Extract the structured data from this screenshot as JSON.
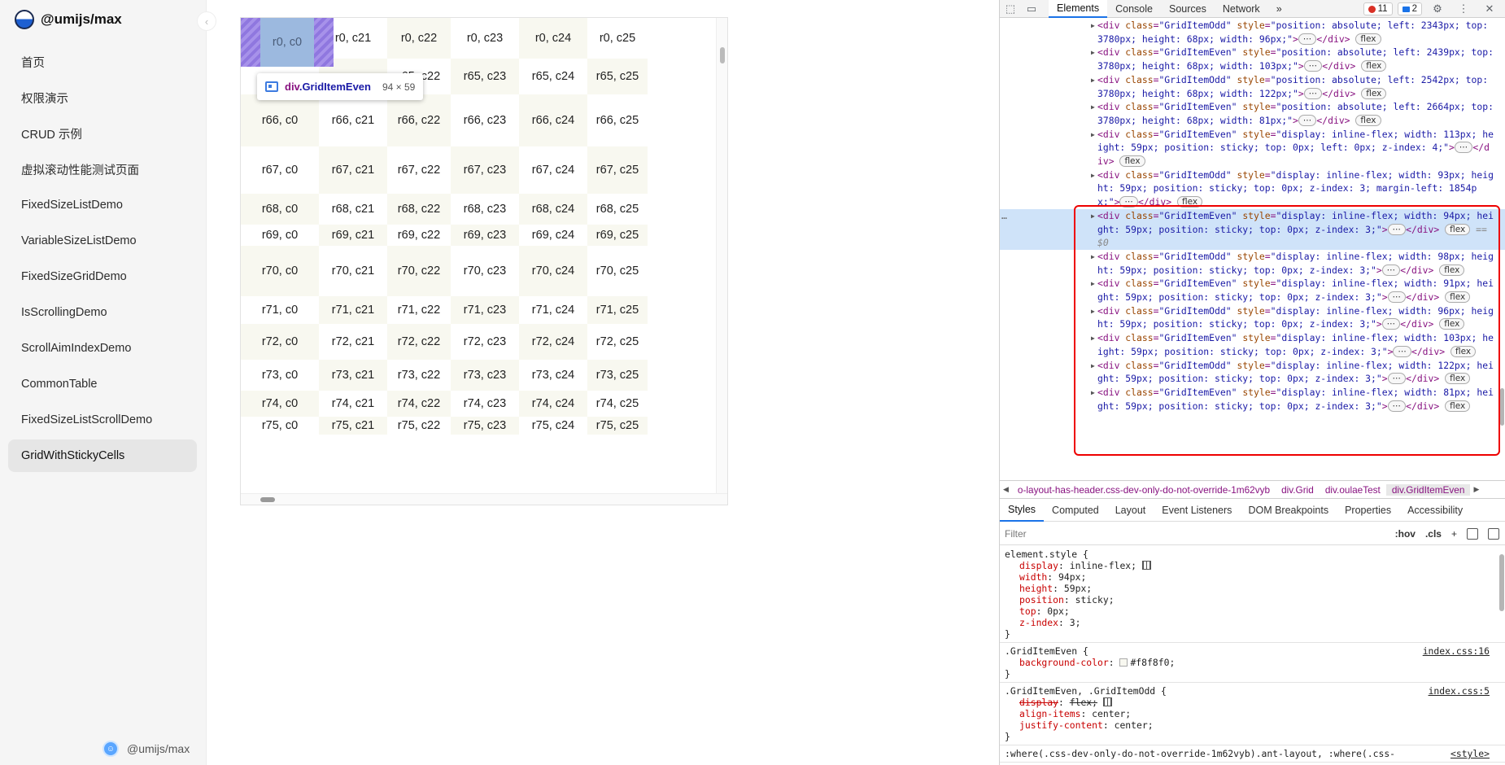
{
  "sidebar": {
    "brand": "@umijs/max",
    "collapse_icon": "‹",
    "items": [
      {
        "label": "首页",
        "active": false
      },
      {
        "label": "权限演示",
        "active": false
      },
      {
        "label": "CRUD 示例",
        "active": false
      },
      {
        "label": "虚拟滚动性能测试页面",
        "active": false
      },
      {
        "label": "FixedSizeListDemo",
        "active": false
      },
      {
        "label": "VariableSizeListDemo",
        "active": false
      },
      {
        "label": "FixedSizeGridDemo",
        "active": false
      },
      {
        "label": "IsScrollingDemo",
        "active": false
      },
      {
        "label": "ScrollAimIndexDemo",
        "active": false
      },
      {
        "label": "CommonTable",
        "active": false
      },
      {
        "label": "FixedSizeListScrollDemo",
        "active": false
      },
      {
        "label": "GridWithStickyCells",
        "active": true
      }
    ],
    "footer": "@umijs/max"
  },
  "grid": {
    "column_labels": [
      "c0",
      "c21",
      "c22",
      "c23",
      "c24",
      "c25"
    ],
    "header_row": [
      "r0, c0",
      "r0, c21",
      "r0, c22",
      "r0, c23",
      "r0, c24",
      "r0, c25"
    ],
    "rows": [
      {
        "label": "r65",
        "cells": [
          "",
          "",
          "r65, c22",
          "r65, c23",
          "r65, c24",
          "r65, c25"
        ]
      },
      {
        "label": "r66",
        "cells": [
          "r66, c0",
          "r66, c21",
          "r66, c22",
          "r66, c23",
          "r66, c24",
          "r66, c25"
        ]
      },
      {
        "label": "r67",
        "cells": [
          "r67, c0",
          "r67, c21",
          "r67, c22",
          "r67, c23",
          "r67, c24",
          "r67, c25"
        ]
      },
      {
        "label": "r68",
        "cells": [
          "r68, c0",
          "r68, c21",
          "r68, c22",
          "r68, c23",
          "r68, c24",
          "r68, c25"
        ]
      },
      {
        "label": "r69",
        "cells": [
          "r69, c0",
          "r69, c21",
          "r69, c22",
          "r69, c23",
          "r69, c24",
          "r69, c25"
        ]
      },
      {
        "label": "r70",
        "cells": [
          "r70, c0",
          "r70, c21",
          "r70, c22",
          "r70, c23",
          "r70, c24",
          "r70, c25"
        ]
      },
      {
        "label": "r71",
        "cells": [
          "r71, c0",
          "r71, c21",
          "r71, c22",
          "r71, c23",
          "r71, c24",
          "r71, c25"
        ]
      },
      {
        "label": "r72",
        "cells": [
          "r72, c0",
          "r72, c21",
          "r72, c22",
          "r72, c23",
          "r72, c24",
          "r72, c25"
        ]
      },
      {
        "label": "r73",
        "cells": [
          "r73, c0",
          "r73, c21",
          "r73, c22",
          "r73, c23",
          "r73, c24",
          "r73, c25"
        ]
      },
      {
        "label": "r74",
        "cells": [
          "r74, c0",
          "r74, c21",
          "r74, c22",
          "r74, c23",
          "r74, c24",
          "r74, c25"
        ]
      },
      {
        "label": "r75",
        "cells": [
          "r75, c0",
          "r75, c21",
          "r75, c22",
          "r75, c23",
          "r75, c24",
          "r75, c25"
        ]
      }
    ],
    "inspect_tooltip": {
      "tag": "div",
      "class": ".GridItemEven",
      "size": "94 × 59"
    },
    "colors": {
      "even": "#f8f8f0",
      "odd": "#ffffff",
      "highlight": "#9cb9df"
    }
  },
  "devtools": {
    "tabs": [
      "Elements",
      "Console",
      "Sources",
      "Network"
    ],
    "active_tab": "Elements",
    "more_tabs": "»",
    "error_count": "11",
    "message_count": "2",
    "element_lines": [
      {
        "cls": "GridItemOdd",
        "style": "position: absolute; left: 2343px; top: 3780px; height: 68px; width: 96px;",
        "selected": false
      },
      {
        "cls": "GridItemEven",
        "style": "position: absolute; left: 2439px; top: 3780px; height: 68px; width: 103px;",
        "selected": false
      },
      {
        "cls": "GridItemOdd",
        "style": "position: absolute; left: 2542px; top: 3780px; height: 68px; width: 122px;",
        "selected": false
      },
      {
        "cls": "GridItemEven",
        "style": "position: absolute; left: 2664px; top: 3780px; height: 68px; width: 81px;",
        "selected": false
      },
      {
        "cls": "GridItemEven",
        "style": "display: inline-flex; width: 113px; height: 59px; position: sticky; top: 0px; left: 0px; z-index: 4;",
        "selected": false
      },
      {
        "cls": "GridItemOdd",
        "style": "display: inline-flex; width: 93px; height: 59px; position: sticky; top: 0px; z-index: 3; margin-left: 1854px;",
        "selected": false
      },
      {
        "cls": "GridItemEven",
        "style": "display: inline-flex; width: 94px; height: 59px; position: sticky; top: 0px; z-index: 3;",
        "selected": true
      },
      {
        "cls": "GridItemOdd",
        "style": "display: inline-flex; width: 98px; height: 59px; position: sticky; top: 0px; z-index: 3;",
        "selected": false
      },
      {
        "cls": "GridItemEven",
        "style": "display: inline-flex; width: 91px; height: 59px; position: sticky; top: 0px; z-index: 3;",
        "selected": false
      },
      {
        "cls": "GridItemOdd",
        "style": "display: inline-flex; width: 96px; height: 59px; position: sticky; top: 0px; z-index: 3;",
        "selected": false
      },
      {
        "cls": "GridItemEven",
        "style": "display: inline-flex; width: 103px; height: 59px; position: sticky; top: 0px; z-index: 3;",
        "selected": false
      },
      {
        "cls": "GridItemOdd",
        "style": "display: inline-flex; width: 122px; height: 59px; position: sticky; top: 0px; z-index: 3;",
        "selected": false
      },
      {
        "cls": "GridItemEven",
        "style": "display: inline-flex; width: 81px; height: 59px; position: sticky; top: 0px; z-index: 3;",
        "selected": false
      }
    ],
    "selected_marker": "== $0",
    "flex_pill": "flex",
    "breadcrumbs": [
      "o-layout-has-header.css-dev-only-do-not-override-1m62vyb",
      "div.Grid",
      "div.oulaeTest",
      "div.GridItemEven"
    ],
    "sub_tabs": [
      "Styles",
      "Computed",
      "Layout",
      "Event Listeners",
      "DOM Breakpoints",
      "Properties",
      "Accessibility"
    ],
    "active_sub_tab": "Styles",
    "filter_placeholder": "Filter",
    "filter_hov": ":hov",
    "filter_cls": ".cls",
    "styles": {
      "element_style_selector": "element.style {",
      "element_style_decls": [
        {
          "prop": "display",
          "val": "inline-flex;",
          "grid": true
        },
        {
          "prop": "width",
          "val": "94px;"
        },
        {
          "prop": "height",
          "val": "59px;"
        },
        {
          "prop": "position",
          "val": "sticky;"
        },
        {
          "prop": "top",
          "val": "0px;"
        },
        {
          "prop": "z-index",
          "val": "3;"
        }
      ],
      "rule2_selector": ".GridItemEven {",
      "rule2_source": "index.css:16",
      "rule2_decl": {
        "prop": "background-color",
        "val": "#f8f8f0;"
      },
      "rule3_selector": ".GridItemEven, .GridItemOdd {",
      "rule3_source": "index.css:5",
      "rule3_decls": [
        {
          "prop": "display",
          "val": "flex;",
          "strike": true
        },
        {
          "prop": "align-items",
          "val": "center;"
        },
        {
          "prop": "justify-content",
          "val": "center;"
        }
      ],
      "rule4_selector": ":where(.css-dev-only-do-not-override-1m62vyb).ant-layout, :where(.css-",
      "rule4_source": "<style>",
      "close_brace": "}"
    }
  }
}
